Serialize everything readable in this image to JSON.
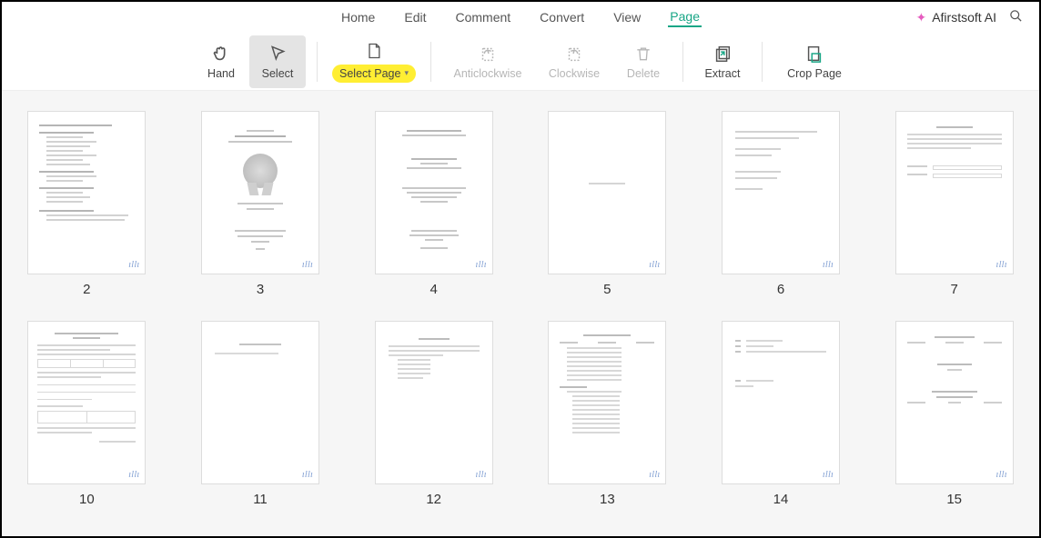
{
  "tabs": {
    "home": "Home",
    "edit": "Edit",
    "comment": "Comment",
    "convert": "Convert",
    "view": "View",
    "page": "Page"
  },
  "ai_label": "Afirstsoft AI",
  "toolbar": {
    "hand": "Hand",
    "select": "Select",
    "select_page": "Select Page",
    "anticlockwise": "Anticlockwise",
    "clockwise": "Clockwise",
    "delete": "Delete",
    "extract": "Extract",
    "crop_page": "Crop Page"
  },
  "pages": {
    "p1": "2",
    "p2": "3",
    "p3": "4",
    "p4": "5",
    "p5": "6",
    "p6": "7",
    "p7": "10",
    "p8": "11",
    "p9": "12",
    "p10": "13",
    "p11": "14",
    "p12": "15"
  }
}
